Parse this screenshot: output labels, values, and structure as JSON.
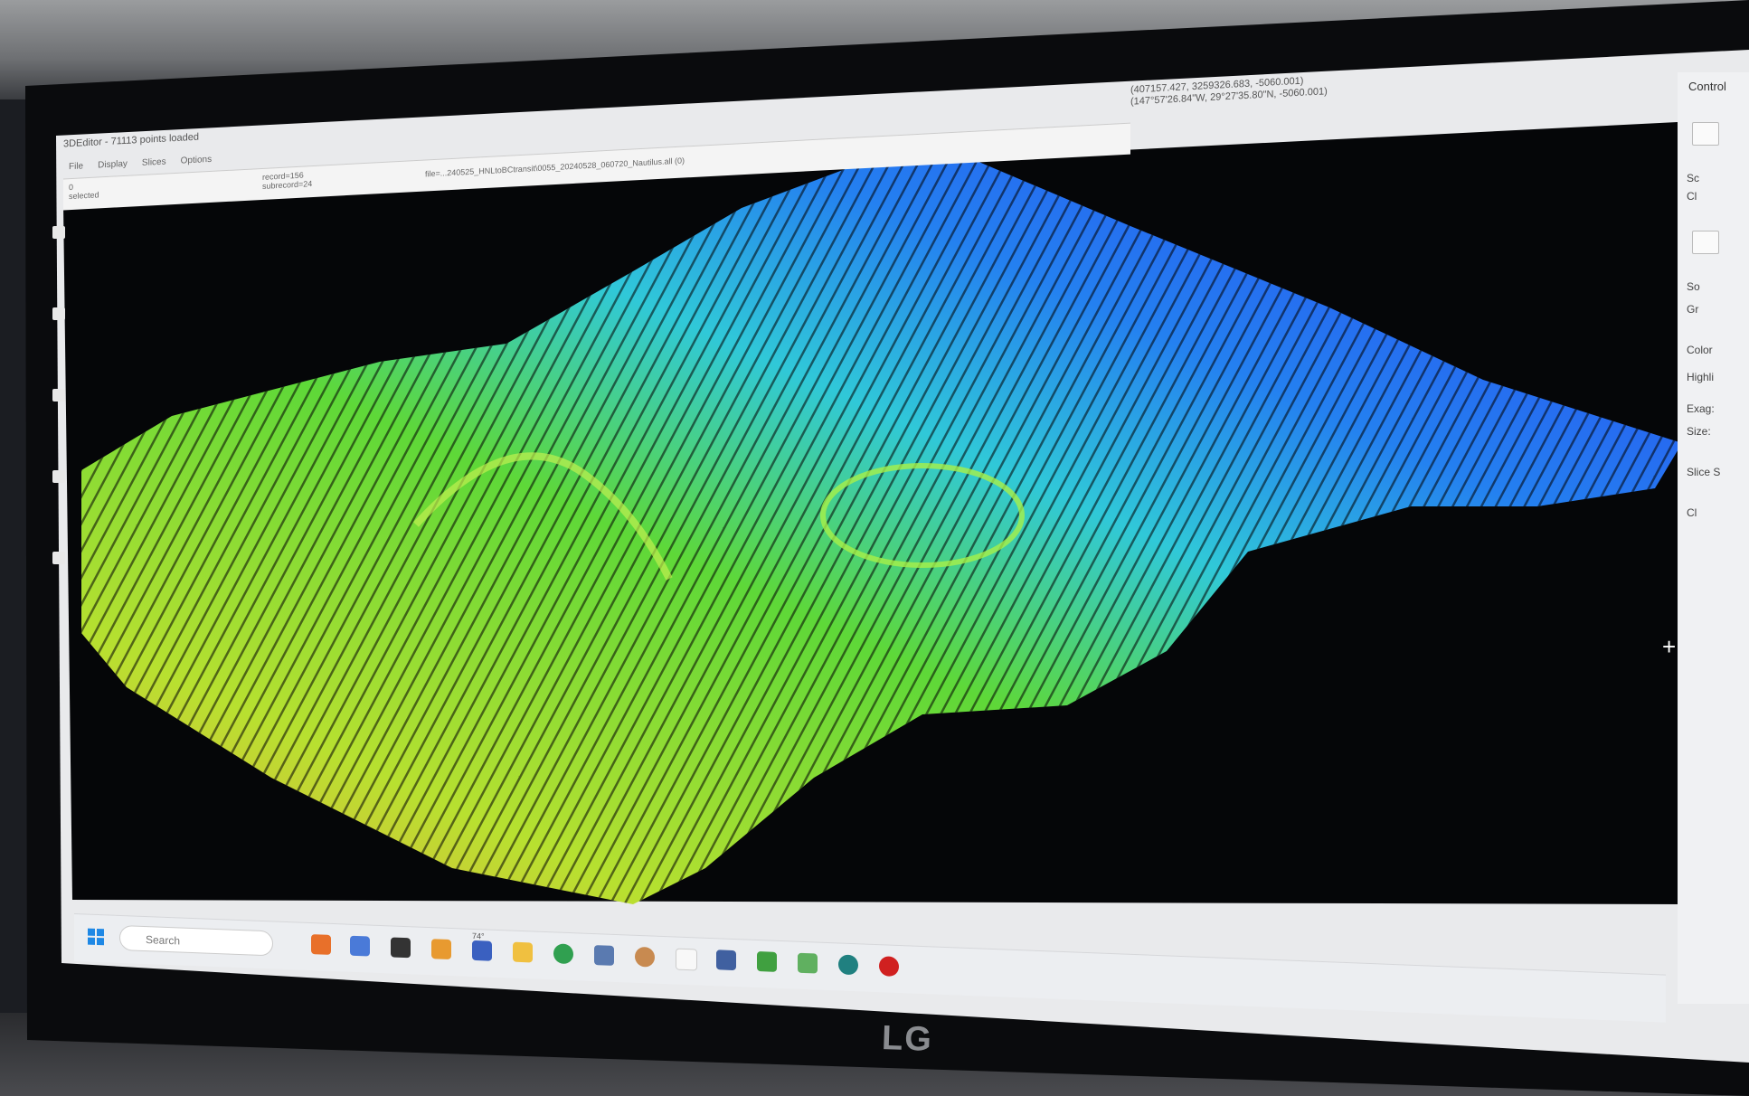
{
  "app": {
    "title": "3DEditor - 71113 points loaded",
    "menu": [
      "File",
      "Display",
      "Slices",
      "Options"
    ],
    "status": {
      "selected": "0\nselected",
      "record": "record=156\nsubrecord=24",
      "file": "file=...240525_HNLtoBCtransit\\0055_20240528_060720_Nautilus.all (0)"
    },
    "coords": {
      "line1": "(407157.427, 3259326.683, -5060.001)",
      "line2": "(147°57'26.84\"W, 29°27'35.80\"N, -5060.001)"
    }
  },
  "control_panel": {
    "title": "Control",
    "radio_1": "Sc",
    "radio_2": "Cl",
    "check_1": "So",
    "check_2": "Gr",
    "color": "Color",
    "highlight": "Highli",
    "exag": "Exag:",
    "size": "Size:",
    "slice": "Slice S",
    "button": "Cl"
  },
  "taskbar": {
    "search_placeholder": "Search",
    "temp_badge": "74°"
  },
  "monitor": {
    "brand": "LG"
  },
  "colors": {
    "deep": "#2a3cf0",
    "mid": "#2fd0e8",
    "shallow": "#86e02a",
    "peak": "#f0c030"
  },
  "icons": [
    "windows-start-icon",
    "search-icon",
    "folder-icon",
    "chrome-icon",
    "app-icon",
    "spreadsheet-icon",
    "calculator-icon",
    "edge-icon"
  ]
}
